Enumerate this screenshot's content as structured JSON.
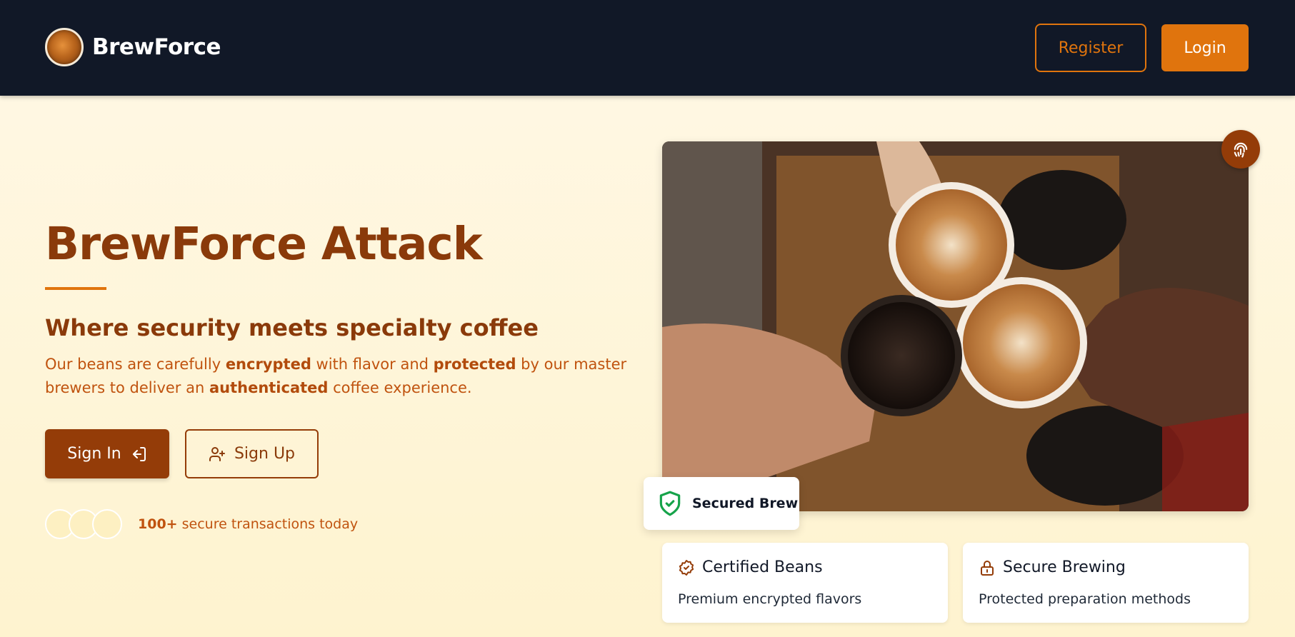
{
  "header": {
    "brand_name": "BrewForce",
    "register_label": "Register",
    "login_label": "Login"
  },
  "hero": {
    "title": "BrewForce Attack",
    "subtitle": "Where security meets specialty coffee",
    "description": {
      "part1": "Our beans are carefully ",
      "bold1": "encrypted",
      "part2": " with flavor and ",
      "bold2": "protected",
      "part3": " by our master brewers to deliver an ",
      "bold3": "authenticated",
      "part4": " coffee experience."
    },
    "signin_label": "Sign In",
    "signup_label": "Sign Up",
    "social_proof_count": "100+",
    "social_proof_text": " secure transactions today"
  },
  "showcase": {
    "secured_badge": "Secured Brew",
    "cards": [
      {
        "title": "Certified Beans",
        "description": "Premium encrypted flavors",
        "icon": "badge-check-icon"
      },
      {
        "title": "Secure Brewing",
        "description": "Protected preparation methods",
        "icon": "lock-icon"
      }
    ]
  },
  "colors": {
    "nav_bg": "#111827",
    "accent": "#e0740d",
    "brand_brown": "#943c08",
    "secure_green": "#16a34a"
  }
}
